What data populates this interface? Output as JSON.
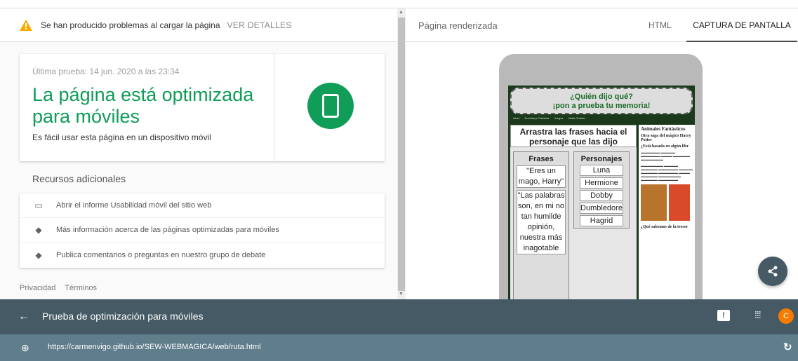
{
  "warning": {
    "text": "Se han producido problemas al cargar la página",
    "details_label": "VER DETALLES"
  },
  "result": {
    "last_test": "Última prueba: 14 jun. 2020 a las 23:34",
    "title_line1": "La página está optimizada",
    "title_line2": "para móviles",
    "subtitle": "Es fácil usar esta página en un dispositivo móvil",
    "icon": "smartphone-icon",
    "accent_color": "#0f9d58"
  },
  "resources": {
    "title": "Recursos adicionales",
    "items": [
      {
        "icon": "report-icon",
        "label": "Abrir el informe Usabilidad móvil del sitio web"
      },
      {
        "icon": "school-icon",
        "label": "Más información acerca de las páginas optimizadas para móviles"
      },
      {
        "icon": "school-icon",
        "label": "Publica comentarios o preguntas en nuestro grupo de debate"
      }
    ]
  },
  "footer": {
    "privacy": "Privacidad",
    "terms": "Términos"
  },
  "right_panel": {
    "rendered_label": "Página renderizada",
    "tabs": [
      {
        "label": "HTML",
        "active": false
      },
      {
        "label": "CAPTURA DE PANTALLA",
        "active": true
      }
    ]
  },
  "screenshot": {
    "banner_line1": "¿Quién dijo qué?",
    "banner_line2": "¡pon a prueba tu memoria!",
    "nav": [
      "Inicio",
      "Novelas y Películas",
      "Juegos",
      "Visita Guiada"
    ],
    "game_title_line1": "Arrastra las frases hacia el",
    "game_title_line2": "personaje que las dijo",
    "frases_head": "Frases",
    "personajes_head": "Personajes",
    "frases": [
      "\"Eres un mago, Harry\"",
      "\"Las palabras son, en mi no tan humilde opinión, nuestra más inagotable"
    ],
    "personajes": [
      "Luna",
      "Hermione",
      "Dobby",
      "Dumbledore",
      "Hagrid"
    ],
    "article_title": "Animales Fantásticos",
    "article_sub": "Otra saga del mágico Harry Potter",
    "article_q1": "¿Está basada en algún libr",
    "article_q2": "¿Qué sabemos de la tercer"
  },
  "app_bar": {
    "title": "Prueba de optimización para móviles",
    "avatar_letter": "C",
    "avatar_color": "#f57c00"
  },
  "url_bar": {
    "url": "https://carmenvigo.github.io/SEW-WEBMAGICA/web/ruta.html"
  }
}
